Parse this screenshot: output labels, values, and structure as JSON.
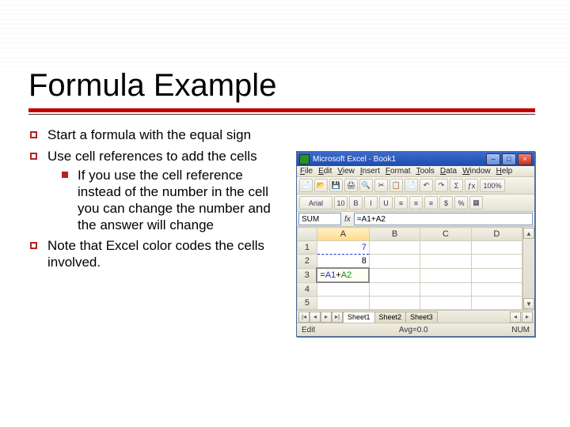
{
  "title": "Formula Example",
  "bullets": {
    "b1": "Start a formula with the equal sign",
    "b2": "Use cell references to add the cells",
    "b2_sub1": "If you use the cell reference instead of the number in the cell you can change the number and the answer will change",
    "b3": "Note that Excel color codes the cells involved."
  },
  "excel": {
    "titlebar": {
      "text": "Microsoft Excel - Book1"
    },
    "menu": {
      "file": "File",
      "edit": "Edit",
      "view": "View",
      "insert": "Insert",
      "format": "Format",
      "tools": "Tools",
      "data": "Data",
      "window": "Window",
      "help": "Help"
    },
    "toolbar1": {
      "i0": "📄",
      "i1": "📂",
      "i2": "💾",
      "i3": "🖨",
      "i4": "🔍",
      "i5": "✂",
      "i6": "📋",
      "i7": "📄",
      "i8": "↶",
      "i9": "↷",
      "i10": "Σ",
      "i11": "ƒx",
      "i12": "100%"
    },
    "toolbar2": {
      "i0": "Arial",
      "i1": "10",
      "i2": "B",
      "i3": "I",
      "i4": "U",
      "i5": "≡",
      "i6": "≡",
      "i7": "≡",
      "i8": "$",
      "i9": "%",
      "i10": "▦"
    },
    "namebox": "SUM",
    "fx_label": "fx",
    "fx_value": "=A1+A2",
    "columns": {
      "a": "A",
      "b": "B",
      "c": "C",
      "d": "D"
    },
    "rows": {
      "r1": "1",
      "r2": "2",
      "r3": "3",
      "r4": "4",
      "r5": "5"
    },
    "cells": {
      "a1": "7",
      "a2": "8",
      "a3_prefix": "=",
      "a3_ref1": "A1",
      "a3_op": "+",
      "a3_ref2": "A2"
    },
    "tabs": {
      "s1": "Sheet1",
      "s2": "Sheet2",
      "s3": "Sheet3"
    },
    "status": {
      "left": "Edit",
      "mid": "Avg=0.0",
      "right": "NUM"
    }
  }
}
